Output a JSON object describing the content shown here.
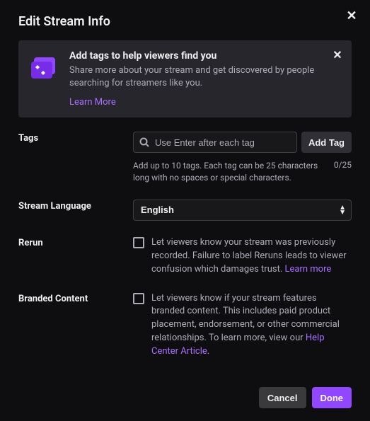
{
  "dialog": {
    "title": "Edit Stream Info"
  },
  "banner": {
    "title": "Add tags to help viewers find you",
    "description": "Share more about your stream and get discovered by people searching for streamers like you.",
    "learn_more": "Learn More"
  },
  "tags": {
    "label": "Tags",
    "placeholder": "Use Enter after each tag",
    "add_button": "Add Tag",
    "help": "Add up to 10 tags. Each tag can be 25 characters long with no spaces or special characters.",
    "counter": "0/25"
  },
  "language": {
    "label": "Stream Language",
    "value": "English"
  },
  "rerun": {
    "label": "Rerun",
    "text_before": "Let viewers know your stream was previously recorded. Failure to label Reruns leads to viewer confusion which damages trust. ",
    "link": "Learn more"
  },
  "branded": {
    "label": "Branded Content",
    "text_before": "Let viewers know if your stream features branded content. This includes paid product placement, endorsement, or other commercial relationships. To learn more, view our ",
    "link": "Help Center Article",
    "text_after": "."
  },
  "footer": {
    "cancel": "Cancel",
    "done": "Done"
  }
}
